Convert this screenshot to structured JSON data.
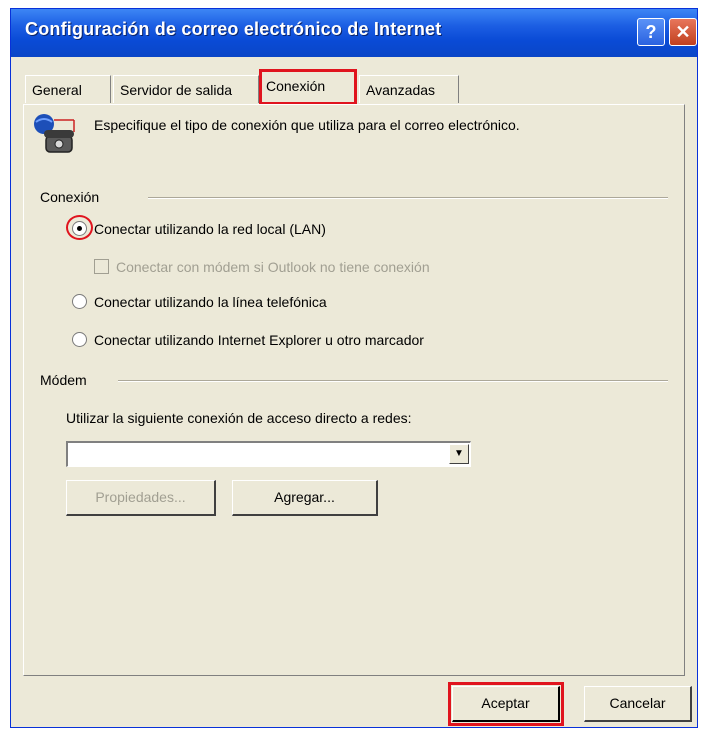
{
  "window": {
    "title": "Configuración de correo electrónico de Internet",
    "help_glyph": "?",
    "close_glyph": "✕"
  },
  "tabs": [
    {
      "label": "General"
    },
    {
      "label": "Servidor de salida"
    },
    {
      "label": "Conexión",
      "active": true
    },
    {
      "label": "Avanzadas"
    }
  ],
  "intro_text": "Especifique el tipo de conexión que utiliza para el correo electrónico.",
  "connection": {
    "section_label": "Conexión",
    "options": [
      {
        "label": "Conectar utilizando la red local (LAN)",
        "selected": true
      },
      {
        "label": "Conectar utilizando la línea telefónica",
        "selected": false
      },
      {
        "label": "Conectar utilizando Internet Explorer u otro marcador",
        "selected": false
      }
    ],
    "modem_checkbox": {
      "label": "Conectar con módem si Outlook no tiene conexión",
      "checked": false,
      "enabled": false
    }
  },
  "modem": {
    "section_label": "Módem",
    "dialup_label": "Utilizar la siguiente conexión de acceso directo a redes:",
    "dialup_value": "",
    "properties_button": "Propiedades...",
    "add_button": "Agregar..."
  },
  "footer": {
    "ok_button": "Aceptar",
    "cancel_button": "Cancelar"
  },
  "colors": {
    "highlight": "#e0141e",
    "titlebar": "#0a4bd6",
    "dialog_bg": "#ece9d8"
  }
}
